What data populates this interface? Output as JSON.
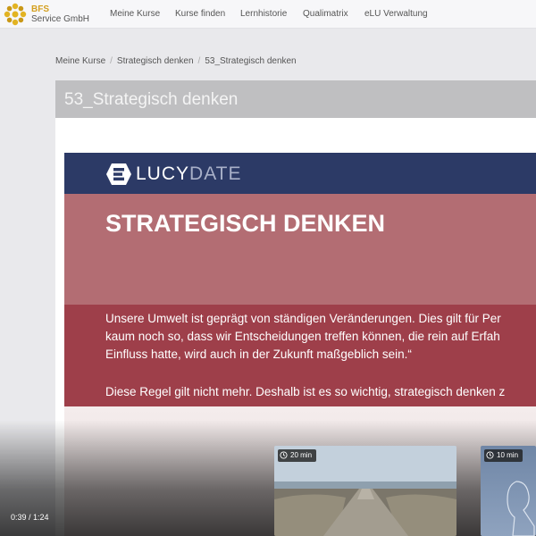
{
  "brand": {
    "line1": "BFS",
    "line2": "Service GmbH",
    "logo_icon": "sun-logo-icon"
  },
  "nav": [
    "Meine Kurse",
    "Kurse finden",
    "Lernhistorie",
    "Qualimatrix",
    "eLU Verwaltung"
  ],
  "breadcrumb": [
    "Meine Kurse",
    "Strategisch denken",
    "53_Strategisch denken"
  ],
  "page_title": "53_Strategisch denken",
  "slide": {
    "logo_lucy": "LUCY",
    "logo_date": "DATE",
    "logo_icon": "lucydate-e-icon",
    "title": "STRATEGISCH DENKEN",
    "lines": [
      "Unsere Umwelt ist geprägt von ständigen Veränderungen. Dies gilt für Per",
      "kaum noch so, dass wir Entscheidungen treffen können, die rein auf Erfah",
      "Einfluss hatte, wird auch in der Zukunft maßgeblich sein.“",
      "Diese Regel gilt nicht mehr. Deshalb ist es so wichtig, strategisch denken z"
    ]
  },
  "thumbnails": [
    {
      "duration": "20 min",
      "icon": "clock-icon"
    },
    {
      "duration": "10 min",
      "icon": "clock-icon"
    }
  ],
  "player": {
    "timecode": "0:39 / 1:24"
  },
  "colors": {
    "slide_header": "#2c3a66",
    "slide_title_band": "#b36d73",
    "slide_text_band": "#9e3f4a",
    "brand_gold": "#d4a020"
  }
}
